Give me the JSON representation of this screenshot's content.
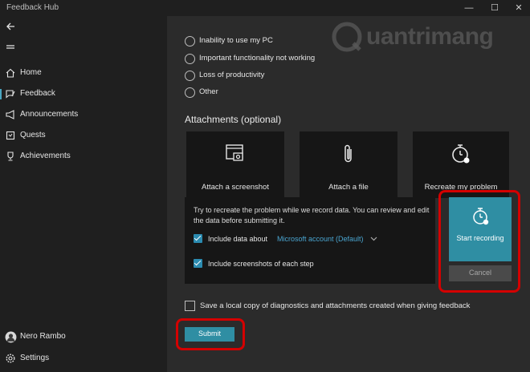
{
  "window": {
    "title": "Feedback Hub",
    "minimize": "—",
    "restore": "☐",
    "close": "✕"
  },
  "sidebar": {
    "back_icon": "back-arrow-icon",
    "menu_icon": "hamburger-icon",
    "items": [
      {
        "label": "Home",
        "icon": "home-icon",
        "active": false
      },
      {
        "label": "Feedback",
        "icon": "feedback-icon",
        "active": true
      },
      {
        "label": "Announcements",
        "icon": "megaphone-icon",
        "active": false
      },
      {
        "label": "Quests",
        "icon": "quests-icon",
        "active": false
      },
      {
        "label": "Achievements",
        "icon": "trophy-icon",
        "active": false
      }
    ],
    "user_name": "Nero Rambo",
    "settings_label": "Settings"
  },
  "impact_options": [
    {
      "label": "Inability to use my PC"
    },
    {
      "label": "Important functionality not working"
    },
    {
      "label": "Loss of productivity"
    },
    {
      "label": "Other"
    }
  ],
  "attachments": {
    "title": "Attachments (optional)",
    "cards": [
      {
        "label": "Attach a screenshot",
        "icon": "screenshot-icon"
      },
      {
        "label": "Attach a file",
        "icon": "paperclip-icon"
      },
      {
        "label": "Recreate my problem",
        "icon": "stopwatch-icon"
      }
    ]
  },
  "recreate": {
    "description": "Try to recreate the problem while we record data. You can review and edit the data before submitting it.",
    "include_data_label": "Include data about",
    "account_value": "Microsoft account (Default)",
    "include_screenshots_label": "Include screenshots of each step",
    "include_data_checked": true,
    "include_screenshots_checked": true,
    "start_label": "Start recording",
    "cancel_label": "Cancel"
  },
  "save_copy_label": "Save a local copy of diagnostics and attachments created when giving feedback",
  "submit_label": "Submit",
  "watermark": {
    "text": "uantrimang"
  },
  "colors": {
    "accent": "#2f8ea3",
    "highlight": "#d40000",
    "link": "#4aa5d0"
  }
}
